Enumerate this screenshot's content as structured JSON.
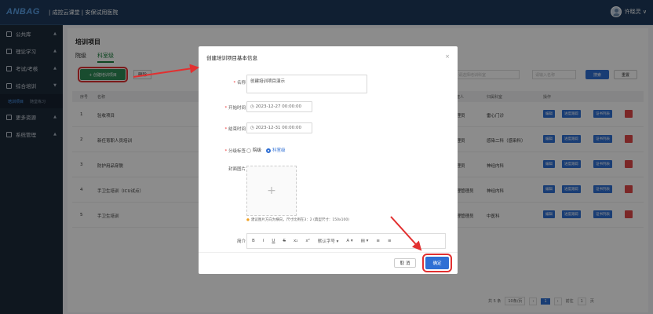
{
  "topbar": {
    "logo": "ANBAG",
    "subtitle": "| 成控云课堂 | 安保试用医院",
    "user": "许晓灵 ∨"
  },
  "sidebar": {
    "items": [
      {
        "label": "公共库"
      },
      {
        "label": "理论学习"
      },
      {
        "label": "考试/考核"
      },
      {
        "label": "综合培训"
      },
      {
        "label": "更多资源"
      },
      {
        "label": "系统管理"
      }
    ],
    "sub": [
      "培训项目",
      "随堂练习"
    ]
  },
  "main": {
    "title": "培训项目",
    "tabs": [
      "院级",
      "科室级"
    ],
    "create_label": "+ 创建培训项目",
    "delete_label": "删除",
    "filter_dept_placeholder": "请选择培训科室",
    "filter_name_placeholder": "请输入名称",
    "search_label": "搜索",
    "reset_label": "重置",
    "columns": [
      "序号",
      "名称",
      "创建人",
      "归属科室",
      "操作"
    ],
    "rows": [
      {
        "no": "1",
        "name": "验收项目",
        "creator": "管理员",
        "dept": "雷心门诊"
      },
      {
        "no": "2",
        "name": "新任育职人员培训",
        "creator": "管理员",
        "dept": "感染二科（感染科）"
      },
      {
        "no": "3",
        "name": "防护用品穿脱",
        "creator": "管理员",
        "dept": "神经内科"
      },
      {
        "no": "4",
        "name": "手卫生培训（ICU试点）",
        "creator": "护理管理员",
        "dept": "神经内科"
      },
      {
        "no": "5",
        "name": "手卫生培训",
        "creator": "护理管理员",
        "dept": "中医科"
      }
    ],
    "actions": [
      "编辑",
      "进度跟踪",
      "证书列表"
    ],
    "pager": {
      "total": "共 5 条",
      "per": "10条/页",
      "page": "1",
      "goto": "前往",
      "goto_page": "1",
      "unit": "页"
    }
  },
  "modal": {
    "title": "创建培训项目基本信息",
    "close": "×",
    "name_label": "名称",
    "name_value": "创建培训项目演示",
    "start_label": "开始时间",
    "start_value": "2023-12-27 00:00:00",
    "end_label": "结束时间",
    "end_value": "2023-12-31 00:00:00",
    "level_label": "分级标签",
    "level_options": [
      "院级",
      "科室级"
    ],
    "cover_label": "封面图片",
    "upload_icon": "+",
    "hint": "建议图片方向为横向，尺寸比例在3：2 (典型尺寸：150x100)",
    "intro_label": "简介",
    "editor_tools": [
      "B",
      "I",
      "U",
      "S",
      "x₂",
      "x²",
      "默认字号 ▾",
      "A ▾",
      "▤ ▾",
      "≡",
      "≡"
    ],
    "cancel": "取 消",
    "confirm": "确定"
  },
  "colors": {
    "primary": "#2f6fd4",
    "highlight": "#e23030",
    "topbar": "#1e3a5c"
  }
}
